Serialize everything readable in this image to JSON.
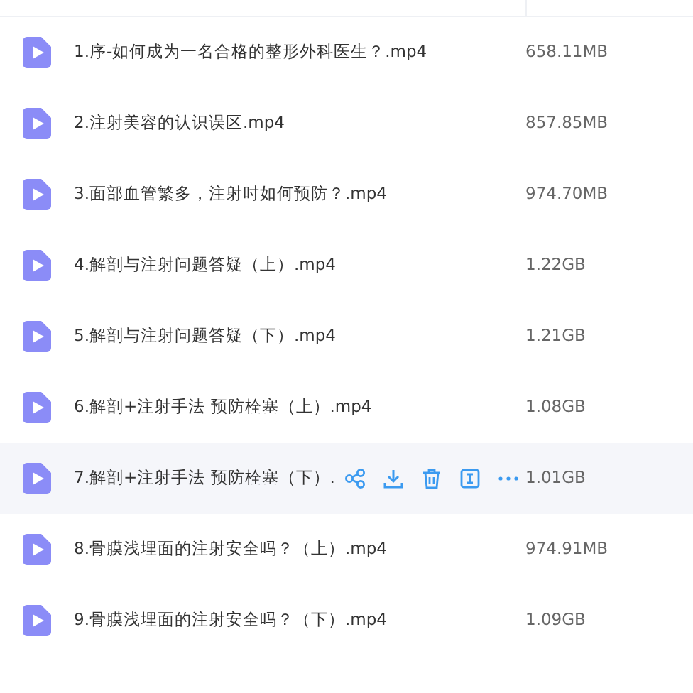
{
  "files": [
    {
      "name": "1.序-如何成为一名合格的整形外科医生？.mp4",
      "size": "658.11MB",
      "selected": false
    },
    {
      "name": "2.注射美容的认识误区.mp4",
      "size": "857.85MB",
      "selected": false
    },
    {
      "name": "3.面部血管繁多，注射时如何预防？.mp4",
      "size": "974.70MB",
      "selected": false
    },
    {
      "name": "4.解剖与注射问题答疑（上）.mp4",
      "size": "1.22GB",
      "selected": false
    },
    {
      "name": "5.解剖与注射问题答疑（下）.mp4",
      "size": "1.21GB",
      "selected": false
    },
    {
      "name": "6.解剖+注射手法 预防栓塞（上）.mp4",
      "size": "1.08GB",
      "selected": false
    },
    {
      "name": "7.解剖+注射手法 预防栓塞（下）.",
      "size": "1.01GB",
      "selected": true
    },
    {
      "name": "8.骨膜浅埋面的注射安全吗？（上）.mp4",
      "size": "974.91MB",
      "selected": false
    },
    {
      "name": "9.骨膜浅埋面的注射安全吗？（下）.mp4",
      "size": "1.09GB",
      "selected": false
    }
  ]
}
